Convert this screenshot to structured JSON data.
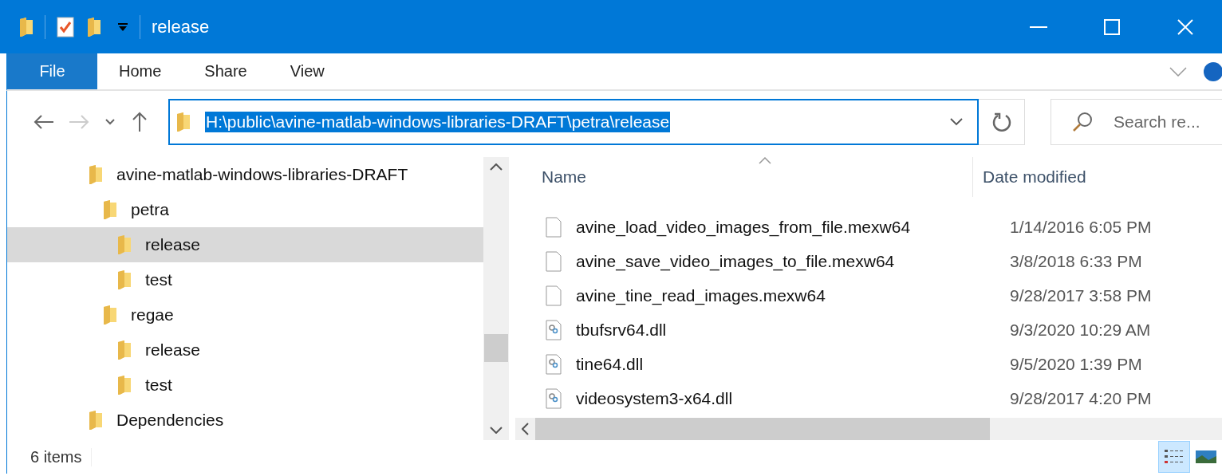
{
  "title_bar": {
    "title": "release"
  },
  "ribbon": {
    "tabs": [
      {
        "label": "File",
        "selected": true
      },
      {
        "label": "Home",
        "selected": false
      },
      {
        "label": "Share",
        "selected": false
      },
      {
        "label": "View",
        "selected": false
      }
    ]
  },
  "address_bar": {
    "value": "H:\\public\\avine-matlab-windows-libraries-DRAFT\\petra\\release",
    "text_selected": true
  },
  "search": {
    "placeholder": "Search re..."
  },
  "tree": [
    {
      "label": "avine-matlab-windows-libraries-DRAFT",
      "selected": false,
      "children": [
        {
          "label": "petra",
          "selected": false,
          "children": [
            {
              "label": "release",
              "selected": true
            },
            {
              "label": "test",
              "selected": false
            }
          ]
        },
        {
          "label": "regae",
          "selected": false,
          "children": [
            {
              "label": "release",
              "selected": false
            },
            {
              "label": "test",
              "selected": false
            }
          ]
        }
      ]
    },
    {
      "label": "Dependencies",
      "selected": false
    }
  ],
  "file_list": {
    "columns": [
      {
        "label": "Name",
        "sorted": true
      },
      {
        "label": "Date modified",
        "sorted": false
      }
    ],
    "rows": [
      {
        "name": "avine_load_video_images_from_file.mexw64",
        "date": "1/14/2016 6:05 PM",
        "kind": "file"
      },
      {
        "name": "avine_save_video_images_to_file.mexw64",
        "date": "3/8/2018 6:33 PM",
        "kind": "file"
      },
      {
        "name": "avine_tine_read_images.mexw64",
        "date": "9/28/2017 3:58 PM",
        "kind": "file"
      },
      {
        "name": "tbufsrv64.dll",
        "date": "9/3/2020 10:29 AM",
        "kind": "dll"
      },
      {
        "name": "tine64.dll",
        "date": "9/5/2020 1:39 PM",
        "kind": "dll"
      },
      {
        "name": "videosystem3-x64.dll",
        "date": "9/28/2017 4:20 PM",
        "kind": "dll"
      }
    ]
  },
  "status_bar": {
    "item_count": "6 items",
    "views": [
      {
        "kind": "details",
        "selected": true
      },
      {
        "kind": "large_icons",
        "selected": false
      }
    ]
  }
}
